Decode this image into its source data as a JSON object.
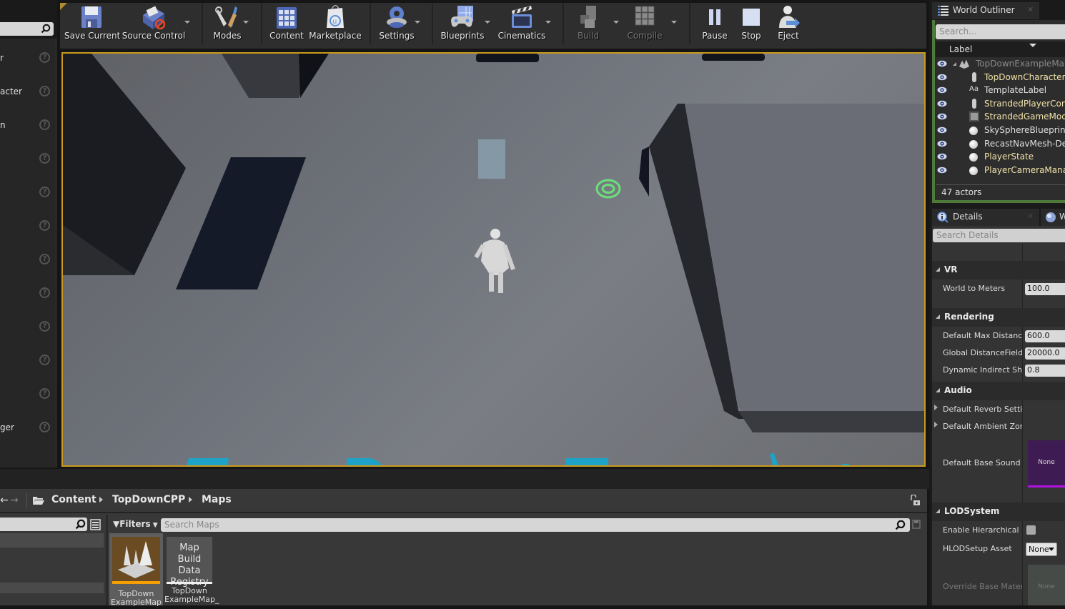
{
  "toolbar": {
    "buttons": [
      {
        "label": "Save Current",
        "icon": "save-icon"
      },
      {
        "label": "Source Control",
        "icon": "source-control-icon"
      },
      {
        "label": "Modes",
        "icon": "modes-icon"
      },
      {
        "label": "Content",
        "icon": "content-icon"
      },
      {
        "label": "Marketplace",
        "icon": "marketplace-icon"
      },
      {
        "label": "Settings",
        "icon": "settings-icon"
      },
      {
        "label": "Blueprints",
        "icon": "blueprints-icon"
      },
      {
        "label": "Cinematics",
        "icon": "cinematics-icon"
      },
      {
        "label": "Build",
        "icon": "build-icon",
        "disabled": true
      },
      {
        "label": "Compile",
        "icon": "compile-icon",
        "disabled": true
      },
      {
        "label": "Pause",
        "icon": "pause-icon"
      },
      {
        "label": "Stop",
        "icon": "stop-icon"
      },
      {
        "label": "Eject",
        "icon": "eject-icon"
      }
    ]
  },
  "left_panel": {
    "rows": [
      "r",
      "acter",
      "n",
      "",
      "",
      "",
      "",
      "",
      "",
      "",
      "",
      "ger"
    ]
  },
  "content_browser": {
    "breadcrumb": [
      "Content",
      "TopDownCPP",
      "Maps"
    ],
    "filters_label": "Filters",
    "search_placeholder": "Search Maps",
    "assets": [
      {
        "name_line1": "TopDown",
        "name_line2": "ExampleMap",
        "type": "map"
      },
      {
        "thumb_text": [
          "Map Build",
          "Data",
          "Registry"
        ],
        "name_line1": "TopDown",
        "name_line2": "ExampleMap_"
      }
    ]
  },
  "world_outliner": {
    "tab_label": "World Outliner",
    "search_placeholder": "Search...",
    "column_label": "Label",
    "items": [
      {
        "label": "TopDownExampleMap",
        "color": "#8a8a8a",
        "icon": "world-icon"
      },
      {
        "label": "TopDownCharacter",
        "color": "#f0e2a8",
        "icon": "character-icon"
      },
      {
        "label": "TemplateLabel",
        "color": "#e0e0e0",
        "icon": "text-render-icon"
      },
      {
        "label": "StrandedPlayerController",
        "color": "#f0e2a8",
        "icon": "controller-icon"
      },
      {
        "label": "StrandedGameMode",
        "color": "#f0e2a8",
        "icon": "game-mode-icon"
      },
      {
        "label": "SkySphereBlueprint",
        "color": "#e0e0e0",
        "icon": "actor-sphere-icon"
      },
      {
        "label": "RecastNavMesh-Default",
        "color": "#e0e0e0",
        "icon": "actor-sphere-icon"
      },
      {
        "label": "PlayerState",
        "color": "#f0e2a8",
        "icon": "actor-sphere-icon"
      },
      {
        "label": "PlayerCameraManager",
        "color": "#f0e2a8",
        "icon": "actor-sphere-icon"
      }
    ],
    "footer": "47 actors"
  },
  "details": {
    "tab_label": "Details",
    "search_placeholder": "Search Details",
    "categories": [
      {
        "name": "VR",
        "props": [
          {
            "label": "World to Meters",
            "value": "100.0"
          }
        ]
      },
      {
        "name": "Rendering",
        "props": [
          {
            "label": "Default Max DistanceField Occlusion Distance",
            "value": "600.0"
          },
          {
            "label": "Global DistanceField View Distance",
            "value": "20000.0"
          },
          {
            "label": "Dynamic Indirect Shadows Self Shadowing Intensity",
            "value": "0.8"
          }
        ]
      },
      {
        "name": "Audio",
        "props": [
          {
            "label": "Default Reverb Settings"
          },
          {
            "label": "Default Ambient Zone Settings"
          },
          {
            "label": "Default Base Sound Mix",
            "value": "None"
          }
        ]
      },
      {
        "name": "LODSystem",
        "props": [
          {
            "label": "Enable Hierarchical LOD System",
            "checked": false
          },
          {
            "label": "HLODSetup Asset",
            "value": "None"
          },
          {
            "label": "Override Base Material",
            "value": "None"
          }
        ]
      }
    ]
  }
}
